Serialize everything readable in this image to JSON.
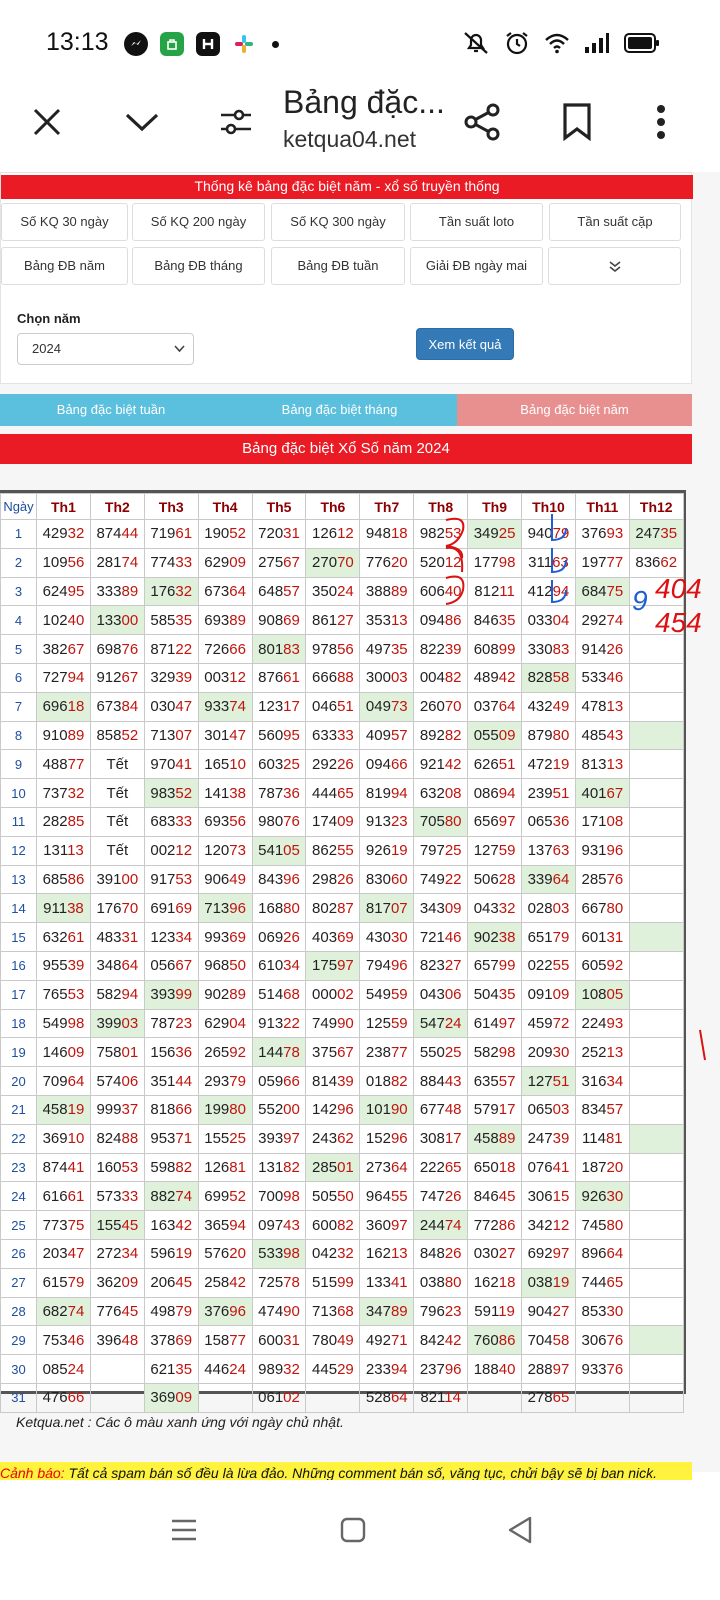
{
  "status": {
    "time": "13:13"
  },
  "toolbar": {
    "title": "Bảng đặc...",
    "domain": "ketqua04.net"
  },
  "panel": {
    "header": "Thống kê bảng đặc biệt năm - xổ số truyền thống",
    "buttons_row1": [
      "Số KQ 30 ngày",
      "Số KQ 200 ngày",
      "Số KQ 300 ngày",
      "Tần suất loto",
      "Tần suất cặp"
    ],
    "buttons_row2": [
      "Bảng ĐB năm",
      "Bảng ĐB tháng",
      "Bảng ĐB tuần",
      "Giải ĐB ngày mai"
    ],
    "year_label": "Chọn năm",
    "year_value": "2024",
    "view_button": "Xem kết quả"
  },
  "tabs": [
    {
      "label": "Bảng đặc biệt tuần",
      "color": "#5bc0de"
    },
    {
      "label": "Bảng đặc biệt tháng",
      "color": "#5bc0de"
    },
    {
      "label": "Bảng đặc biệt năm",
      "color": "#e89090"
    }
  ],
  "table": {
    "title": "Bảng đặc biệt Xổ Số năm 2024",
    "day_header": "Ngày",
    "months": [
      "Th1",
      "Th2",
      "Th3",
      "Th4",
      "Th5",
      "Th6",
      "Th7",
      "Th8",
      "Th9",
      "Th10",
      "Th11",
      "Th12"
    ],
    "rows": [
      [
        "42932",
        "87444",
        "71961",
        "19052",
        "72031",
        "12612",
        "94818",
        "98253",
        "34925",
        "94079",
        "37693",
        "24735"
      ],
      [
        "10956",
        "28174",
        "77433",
        "62909",
        "27567",
        "27070",
        "77620",
        "52012",
        "17798",
        "31163",
        "19777",
        "83662"
      ],
      [
        "62495",
        "33389",
        "17632",
        "67364",
        "64857",
        "35024",
        "38889",
        "60640",
        "81211",
        "41294",
        "68475",
        ""
      ],
      [
        "10240",
        "13300",
        "58535",
        "69389",
        "90869",
        "86127",
        "35313",
        "09486",
        "84635",
        "03304",
        "29274",
        ""
      ],
      [
        "38267",
        "69876",
        "87122",
        "72666",
        "80183",
        "97856",
        "49735",
        "82239",
        "60899",
        "33083",
        "91426",
        ""
      ],
      [
        "72794",
        "91267",
        "32939",
        "00312",
        "87661",
        "66688",
        "30003",
        "00482",
        "48942",
        "82858",
        "53346",
        ""
      ],
      [
        "69618",
        "67384",
        "03047",
        "93374",
        "12317",
        "04651",
        "04973",
        "26070",
        "03764",
        "43249",
        "47813",
        ""
      ],
      [
        "91089",
        "85852",
        "71307",
        "30147",
        "56095",
        "63333",
        "40957",
        "89282",
        "05509",
        "87980",
        "48543",
        ""
      ],
      [
        "48877",
        "Tết",
        "97041",
        "16510",
        "60325",
        "29226",
        "09466",
        "92142",
        "62651",
        "47219",
        "81313",
        ""
      ],
      [
        "73732",
        "Tết",
        "98352",
        "14138",
        "78736",
        "44465",
        "81994",
        "63208",
        "08694",
        "23951",
        "40167",
        ""
      ],
      [
        "28285",
        "Tết",
        "68333",
        "69356",
        "98076",
        "17409",
        "91323",
        "70580",
        "65697",
        "06536",
        "17108",
        ""
      ],
      [
        "13113",
        "Tết",
        "00212",
        "12073",
        "54105",
        "86255",
        "92619",
        "79725",
        "12759",
        "13763",
        "93196",
        ""
      ],
      [
        "68586",
        "39100",
        "91753",
        "90649",
        "84396",
        "29826",
        "83060",
        "74922",
        "50628",
        "33964",
        "28576",
        ""
      ],
      [
        "91138",
        "17670",
        "69169",
        "71396",
        "16880",
        "80287",
        "81707",
        "34309",
        "04332",
        "02803",
        "66780",
        ""
      ],
      [
        "63261",
        "48331",
        "12334",
        "99369",
        "06926",
        "40369",
        "43030",
        "72146",
        "90238",
        "65179",
        "60131",
        ""
      ],
      [
        "95539",
        "34864",
        "05667",
        "96850",
        "61034",
        "17597",
        "79496",
        "82327",
        "65799",
        "02255",
        "60592",
        ""
      ],
      [
        "76553",
        "58294",
        "39399",
        "90289",
        "51468",
        "00002",
        "54959",
        "04306",
        "50435",
        "09109",
        "10805",
        ""
      ],
      [
        "54998",
        "39903",
        "78723",
        "62904",
        "91322",
        "74990",
        "12559",
        "54724",
        "61497",
        "45972",
        "22493",
        ""
      ],
      [
        "14609",
        "75801",
        "15636",
        "26592",
        "14478",
        "37567",
        "23877",
        "55025",
        "58298",
        "20930",
        "25213",
        ""
      ],
      [
        "70964",
        "57406",
        "35144",
        "29379",
        "05966",
        "81439",
        "01882",
        "88443",
        "63557",
        "12751",
        "31634",
        ""
      ],
      [
        "45819",
        "99937",
        "81866",
        "19980",
        "55200",
        "14296",
        "10190",
        "67748",
        "57917",
        "06503",
        "83457",
        ""
      ],
      [
        "36910",
        "82488",
        "95371",
        "15525",
        "39397",
        "24362",
        "15296",
        "30817",
        "45889",
        "24739",
        "11481",
        ""
      ],
      [
        "87441",
        "16053",
        "59882",
        "12681",
        "13182",
        "28501",
        "27364",
        "22265",
        "65018",
        "07641",
        "18720",
        ""
      ],
      [
        "61661",
        "57333",
        "88274",
        "69952",
        "70098",
        "50550",
        "96455",
        "74726",
        "84645",
        "30615",
        "92630",
        ""
      ],
      [
        "77375",
        "15545",
        "16342",
        "36594",
        "09743",
        "60082",
        "36097",
        "24474",
        "77286",
        "34212",
        "74580",
        ""
      ],
      [
        "20347",
        "27234",
        "59619",
        "57620",
        "53398",
        "04232",
        "16213",
        "84826",
        "03027",
        "69297",
        "89664",
        ""
      ],
      [
        "61579",
        "36209",
        "20645",
        "25842",
        "72578",
        "51599",
        "13341",
        "03880",
        "16218",
        "03819",
        "74465",
        ""
      ],
      [
        "68274",
        "77645",
        "49879",
        "37696",
        "47490",
        "71368",
        "34789",
        "79623",
        "59119",
        "90427",
        "85330",
        ""
      ],
      [
        "75346",
        "39648",
        "37869",
        "15877",
        "60031",
        "78049",
        "49271",
        "84242",
        "76086",
        "70458",
        "30676",
        ""
      ],
      [
        "08524",
        "",
        "62135",
        "44624",
        "98932",
        "44529",
        "23394",
        "23796",
        "18840",
        "28897",
        "93376",
        ""
      ],
      [
        "47666",
        "",
        "36909",
        "",
        "06102",
        "",
        "52864",
        "82114",
        "",
        "27865",
        "",
        ""
      ]
    ],
    "sundays": [
      [
        1,
        8
      ],
      [
        1,
        11
      ],
      [
        2,
        5
      ],
      [
        3,
        2
      ],
      [
        3,
        10
      ],
      [
        4,
        1
      ],
      [
        5,
        4
      ],
      [
        6,
        9
      ],
      [
        6,
        12
      ],
      [
        7,
        0
      ],
      [
        7,
        3
      ],
      [
        7,
        6
      ],
      [
        8,
        8
      ],
      [
        8,
        11
      ],
      [
        10,
        2
      ],
      [
        10,
        10
      ],
      [
        11,
        7
      ],
      [
        12,
        4
      ],
      [
        13,
        9
      ],
      [
        14,
        0
      ],
      [
        14,
        3
      ],
      [
        14,
        6
      ],
      [
        15,
        8
      ],
      [
        15,
        11
      ],
      [
        16,
        5
      ],
      [
        17,
        2
      ],
      [
        17,
        10
      ],
      [
        18,
        1
      ],
      [
        18,
        7
      ],
      [
        19,
        4
      ],
      [
        20,
        9
      ],
      [
        21,
        0
      ],
      [
        21,
        3
      ],
      [
        21,
        6
      ],
      [
        22,
        8
      ],
      [
        22,
        11
      ],
      [
        23,
        5
      ],
      [
        24,
        2
      ],
      [
        24,
        10
      ],
      [
        25,
        1
      ],
      [
        25,
        7
      ],
      [
        26,
        4
      ],
      [
        27,
        9
      ],
      [
        28,
        0
      ],
      [
        28,
        3
      ],
      [
        28,
        6
      ],
      [
        29,
        8
      ],
      [
        29,
        11
      ],
      [
        31,
        2
      ]
    ]
  },
  "note": "Ketqua.net : Các ô màu xanh ứng với ngày chủ nhật.",
  "warning": {
    "label": "Cảnh báo:",
    "text": " Tất cả spam bán số đều là lừa đảo. Những comment bán số, văng tục, chửi bậy sẽ bị ban nick."
  },
  "handwriting": {
    "a": "404",
    "b": "454",
    "c": "9"
  }
}
